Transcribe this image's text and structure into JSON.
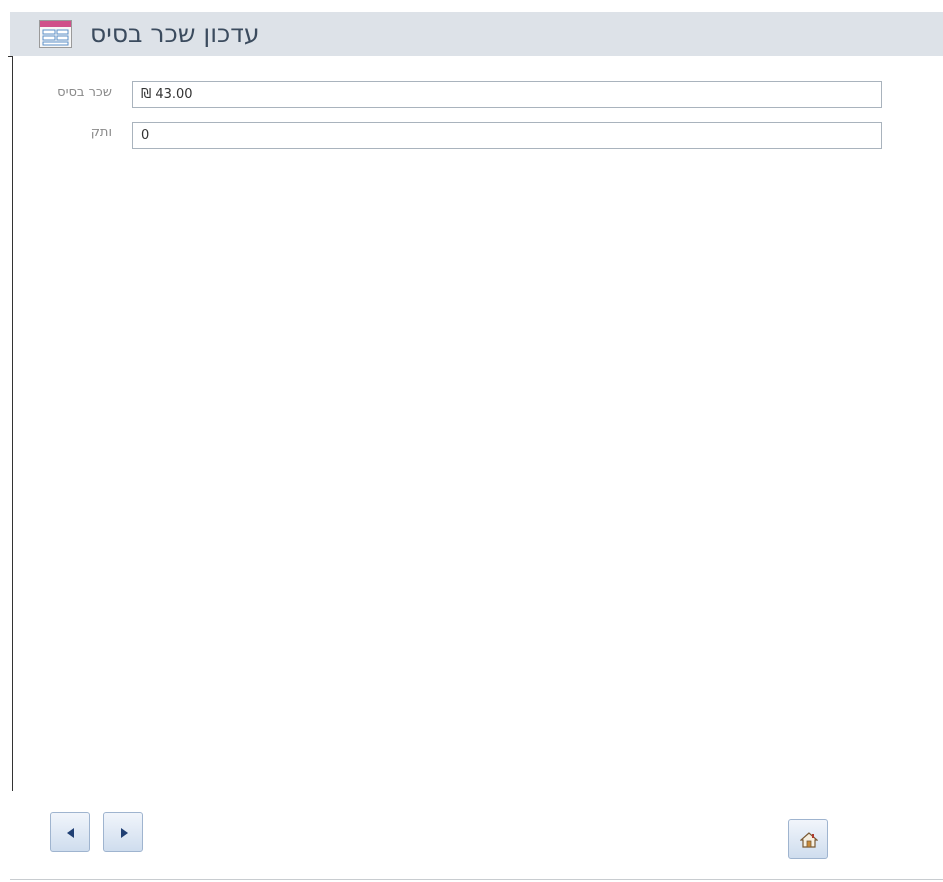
{
  "header": {
    "title": "עדכון שכר בסיס",
    "icon": "form-icon"
  },
  "fields": [
    {
      "label": "שכר בסיס",
      "value": "₪ 43.00"
    },
    {
      "label": "ותק",
      "value": "0"
    }
  ],
  "navigation": {
    "previous_icon": "arrow-left-icon",
    "next_icon": "arrow-right-icon",
    "home_icon": "home-icon"
  }
}
